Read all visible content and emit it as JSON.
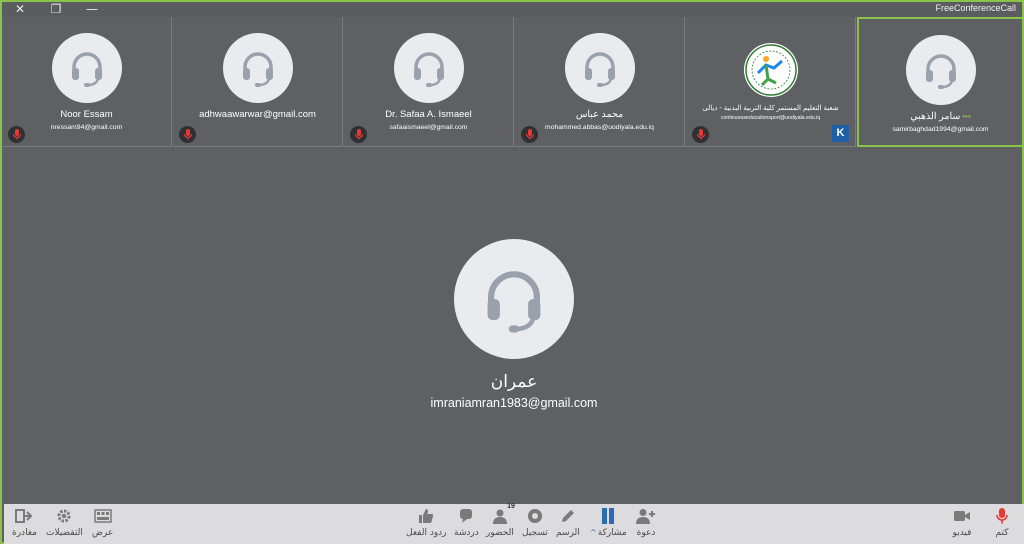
{
  "window": {
    "title": "FreeConferenceCall",
    "close_glyph": "✕",
    "restore_glyph": "❐",
    "minimize_glyph": "—"
  },
  "participants": [
    {
      "name": "Noor Essam",
      "email": "nressam94@gmail.com",
      "muted": true,
      "icon": "headset-icon"
    },
    {
      "name": "adhwaawarwar@gmail.com",
      "email": "",
      "muted": true,
      "icon": "headset-icon"
    },
    {
      "name": "Dr. Safaa A. Ismaeel",
      "email": "safaaismaeel@gmail.com",
      "muted": true,
      "icon": "headset-icon"
    },
    {
      "name": "محمد عباس",
      "email": "mohammed.abbas@uodiyala.edu.iq",
      "muted": true,
      "icon": "headset-icon"
    },
    {
      "name": "شعبة التعليم المستمر كلية التربية البدنية - ديالى",
      "email": "continuouseducationsport@uodiyala.edu.iq",
      "muted": true,
      "icon": "college-logo-icon",
      "badge": "K"
    },
    {
      "name": "سامر الذهبي",
      "email": "samirbaghdad1994@gmail.com",
      "muted": false,
      "icon": "headset-icon",
      "speaking_dots": "•••",
      "active": true
    }
  ],
  "main_speaker": {
    "name": "عمران",
    "email": "imraniamran1983@gmail.com"
  },
  "toolbar": {
    "left": [
      {
        "label": "مغادرة",
        "icon": "leave-icon"
      },
      {
        "label": "التفضيلات",
        "icon": "gear-icon"
      },
      {
        "label": "عرض",
        "icon": "layout-icon"
      }
    ],
    "center": [
      {
        "label": "ردود الفعل",
        "icon": "thumbs-up-icon"
      },
      {
        "label": "دردشة",
        "icon": "chat-icon"
      },
      {
        "label": "الحضور",
        "icon": "attendees-icon",
        "count": "19"
      },
      {
        "label": "تسجيل",
        "icon": "record-icon"
      },
      {
        "label": "الرسم",
        "icon": "pen-icon"
      },
      {
        "label": "مشاركة",
        "icon": "share-icon"
      },
      {
        "label": "دعوة",
        "icon": "invite-icon"
      }
    ],
    "right": [
      {
        "label": "فيديو",
        "icon": "video-icon"
      },
      {
        "label": "كتم",
        "icon": "mic-muted-icon"
      }
    ]
  },
  "colors": {
    "active_border": "#8bc34a",
    "background": "#5f6063",
    "muted_mic": "#e53935",
    "toolbar_bg": "#dcdcde",
    "accent_blue": "#2b6cb0"
  }
}
